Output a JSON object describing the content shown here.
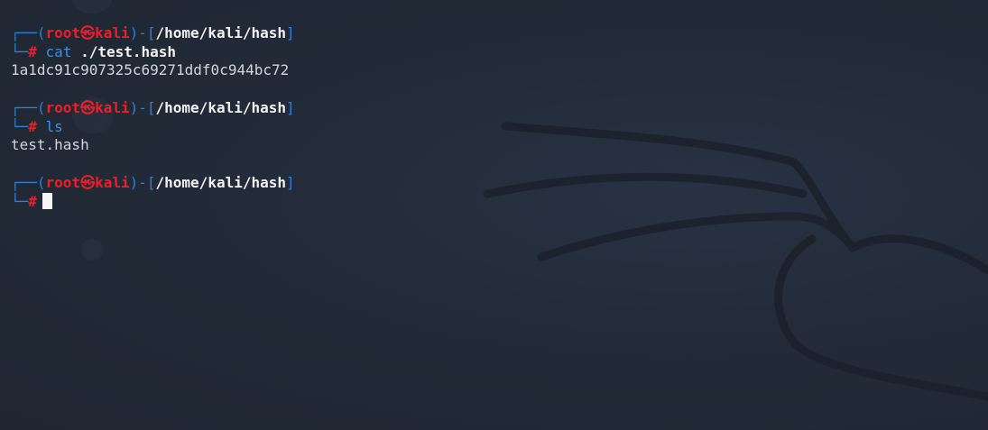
{
  "terminal": {
    "user": "root",
    "host": "kali",
    "separator": "㉿",
    "cwd": "/home/kali/hash",
    "prompt_symbol": "#",
    "cmd1": {
      "command": "cat",
      "argument": "./test.hash",
      "output": "1a1dc91c907325c69271ddf0c944bc72"
    },
    "cmd2": {
      "command": "ls",
      "output": "test.hash"
    }
  },
  "colors": {
    "background": "#222a37",
    "prompt_box": "#2f7fd8",
    "user_host": "#e8202b",
    "command": "#3d8ee6",
    "text": "#f2f2f2"
  },
  "icons": [
    "skull-separator-icon",
    "cursor-block"
  ]
}
